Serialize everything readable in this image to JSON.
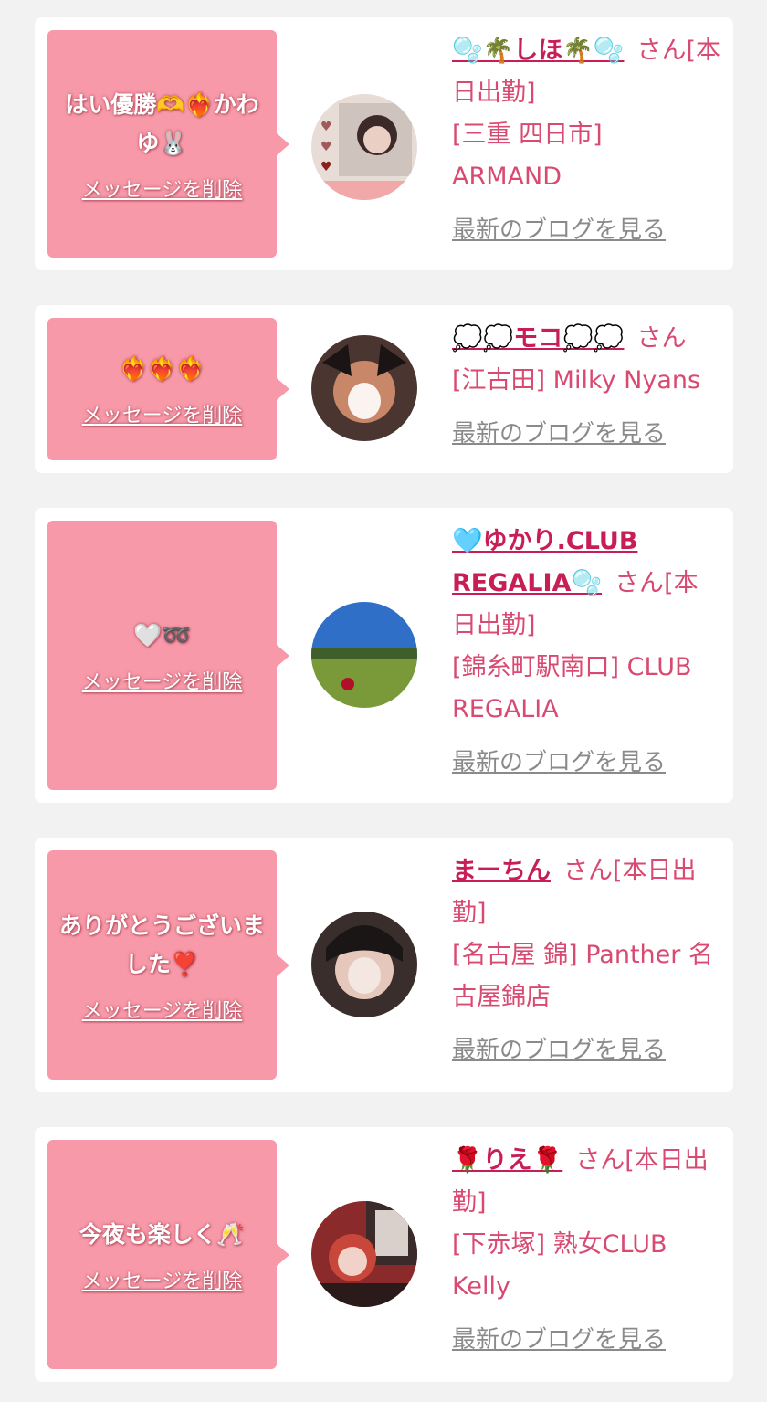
{
  "colors": {
    "page_bg": "#f2f2f2",
    "card_bg": "#ffffff",
    "bubble": "#f799a8",
    "name": "#c81e56",
    "text": "#d94a72",
    "link": "#8a8a8a"
  },
  "delete_label": "メッセージを削除",
  "blog_label": "最新のブログを見る",
  "san_label": "さん",
  "cards": [
    {
      "message": "はい優勝🫶❤️‍🔥かわゆ🐰",
      "name": "🫧🌴しほ🌴🫧",
      "status": "[本日出勤]",
      "location": "[三重 四日市] ARMAND"
    },
    {
      "message": "❤️‍🔥❤️‍🔥❤️‍🔥",
      "name": "💭💭モコ💭💭",
      "status": "",
      "location": "[江古田] Milky Nyans"
    },
    {
      "message": "🤍➿",
      "name": "🩵ゆかり.CLUB REGALIA🫧",
      "status": "[本日出勤]",
      "location": "[錦糸町駅南口] CLUB REGALIA"
    },
    {
      "message": "ありがとうございました❣️",
      "name": "まーちん",
      "status": "[本日出勤]",
      "location": "[名古屋 錦] Panther 名古屋錦店"
    },
    {
      "message": "今夜も楽しく🥂",
      "name": "🌹りえ🌹",
      "status": "[本日出勤]",
      "location": "[下赤塚] 熟女CLUB Kelly"
    }
  ]
}
